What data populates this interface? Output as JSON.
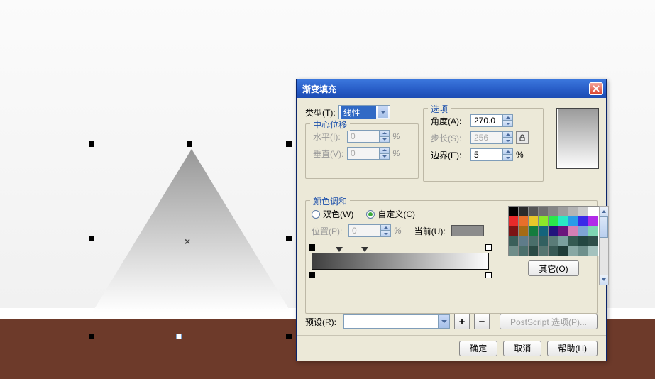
{
  "dialog": {
    "title": "渐变填充",
    "type_label": "类型(T):",
    "type_value": "线性",
    "center_offset_label": "中心位移",
    "horizontal_label": "水平(I):",
    "horizontal_value": "0",
    "vertical_label": "垂直(V):",
    "vertical_value": "0",
    "percent": "%",
    "options_label": "选项",
    "angle_label": "角度(A):",
    "angle_value": "270.0",
    "step_label": "步长(S):",
    "step_value": "256",
    "edge_label": "边界(E):",
    "edge_value": "5",
    "blend_label": "颜色调和",
    "two_color_label": "双色(W)",
    "custom_label": "自定义(C)",
    "position_label": "位置(P):",
    "position_value": "0",
    "current_label": "当前(U):",
    "other_label": "其它(O)",
    "preset_label": "预设(R):",
    "postscript_label": "PostScript 选项(P)...",
    "ok_label": "确定",
    "cancel_label": "取消",
    "help_label": "帮助(H)"
  },
  "palette": [
    "#000000",
    "#2b2b2b",
    "#555555",
    "#6f6f6f",
    "#868686",
    "#9d9d9d",
    "#b4b4b4",
    "#cbcbcb",
    "#ffffff",
    "#e82a2a",
    "#e86f2a",
    "#e8c72a",
    "#8de82a",
    "#2ae84b",
    "#2ae8c4",
    "#2a9be8",
    "#3a2ae8",
    "#b22ae8",
    "#7c1414",
    "#a66b14",
    "#147c3e",
    "#14647c",
    "#22147c",
    "#6b147c",
    "#d67fb5",
    "#7fa5d6",
    "#7fd6b3",
    "#3a5f5a",
    "#5f7c8a",
    "#4a6e6a",
    "#326060",
    "#5a7c78",
    "#7aa09e",
    "#355a52",
    "#244742",
    "#2f4f4a",
    "#6f8d89",
    "#4b6f6b",
    "#2a4a44",
    "#557570",
    "#385a55",
    "#1f3d38",
    "#88a8a4",
    "#6e908c",
    "#a4c2be"
  ]
}
